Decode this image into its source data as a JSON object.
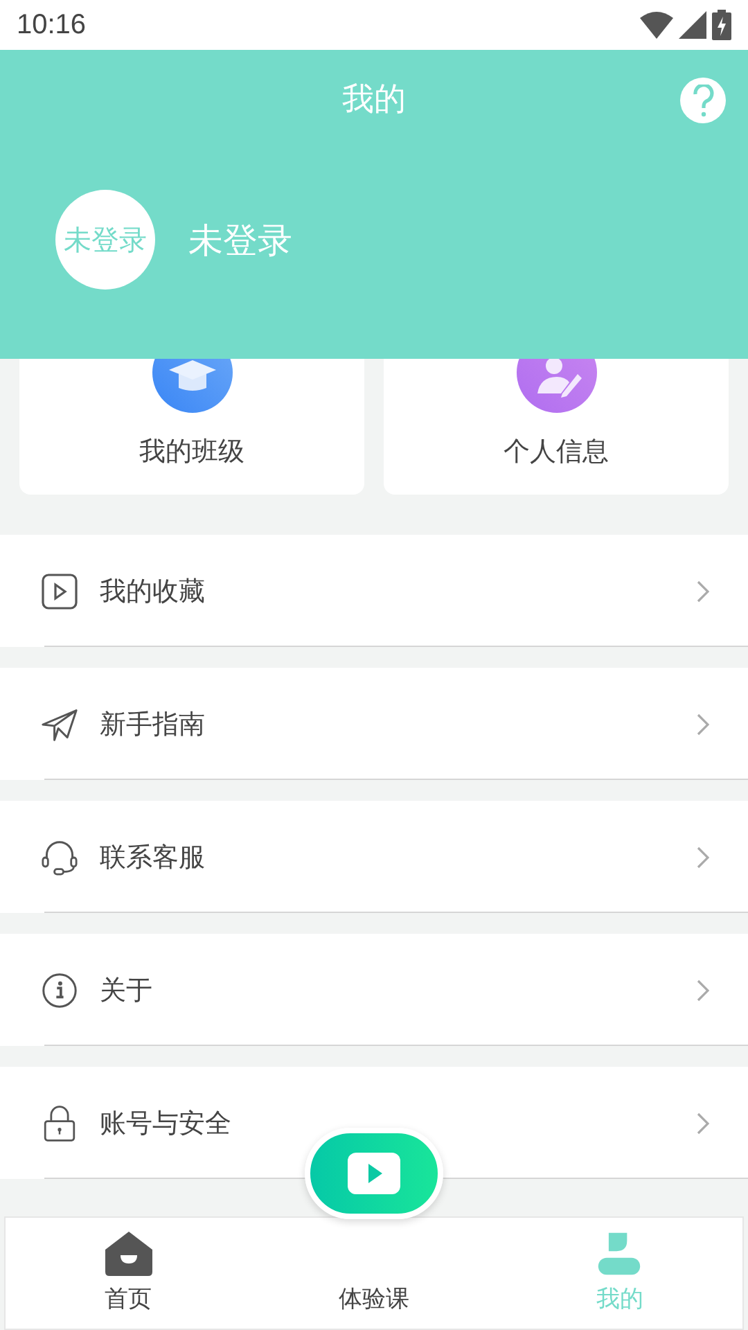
{
  "status_bar": {
    "time": "10:16"
  },
  "header": {
    "title": "我的",
    "avatar_text": "未登录",
    "user_name": "未登录"
  },
  "quick_cards": [
    {
      "kind": "class",
      "label": "我的班级"
    },
    {
      "kind": "profile",
      "label": "个人信息"
    }
  ],
  "menu": [
    {
      "kind": "play",
      "label": "我的收藏"
    },
    {
      "kind": "plane",
      "label": "新手指南"
    },
    {
      "kind": "headset",
      "label": "联系客服"
    },
    {
      "kind": "info",
      "label": "关于"
    },
    {
      "kind": "lock",
      "label": "账号与安全"
    }
  ],
  "tabs": [
    {
      "kind": "home",
      "label": "首页",
      "selected": false
    },
    {
      "kind": "none",
      "label": "体验课",
      "selected": false
    },
    {
      "kind": "person",
      "label": "我的",
      "selected": true
    }
  ]
}
